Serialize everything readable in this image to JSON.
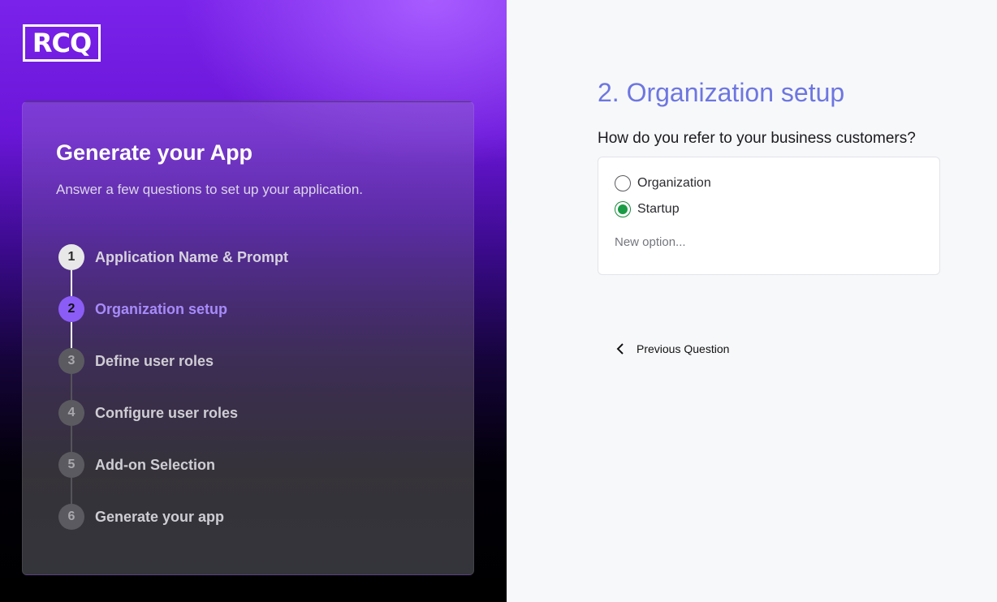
{
  "brand": {
    "logo_text": "RCQ"
  },
  "sidebar": {
    "title": "Generate your App",
    "subtitle": "Answer a few questions to set up your application.",
    "steps": [
      {
        "number": "1",
        "label": "Application Name & Prompt",
        "state": "done"
      },
      {
        "number": "2",
        "label": "Organization setup",
        "state": "active"
      },
      {
        "number": "3",
        "label": "Define user roles",
        "state": "todo"
      },
      {
        "number": "4",
        "label": "Configure user roles",
        "state": "todo"
      },
      {
        "number": "5",
        "label": "Add-on Selection",
        "state": "todo"
      },
      {
        "number": "6",
        "label": "Generate your app",
        "state": "todo"
      }
    ]
  },
  "main": {
    "heading": "2. Organization setup",
    "question": "How do you refer to your business customers?",
    "options": [
      {
        "label": "Organization",
        "selected": false
      },
      {
        "label": "Startup",
        "selected": true
      }
    ],
    "new_option_placeholder": "New option...",
    "prev_label": "Previous Question"
  },
  "colors": {
    "accent": "#8b5cf6",
    "heading": "#6d76e0",
    "radio_selected": "#1a9b45"
  },
  "icons": {
    "prev": "chevron-left-icon"
  }
}
